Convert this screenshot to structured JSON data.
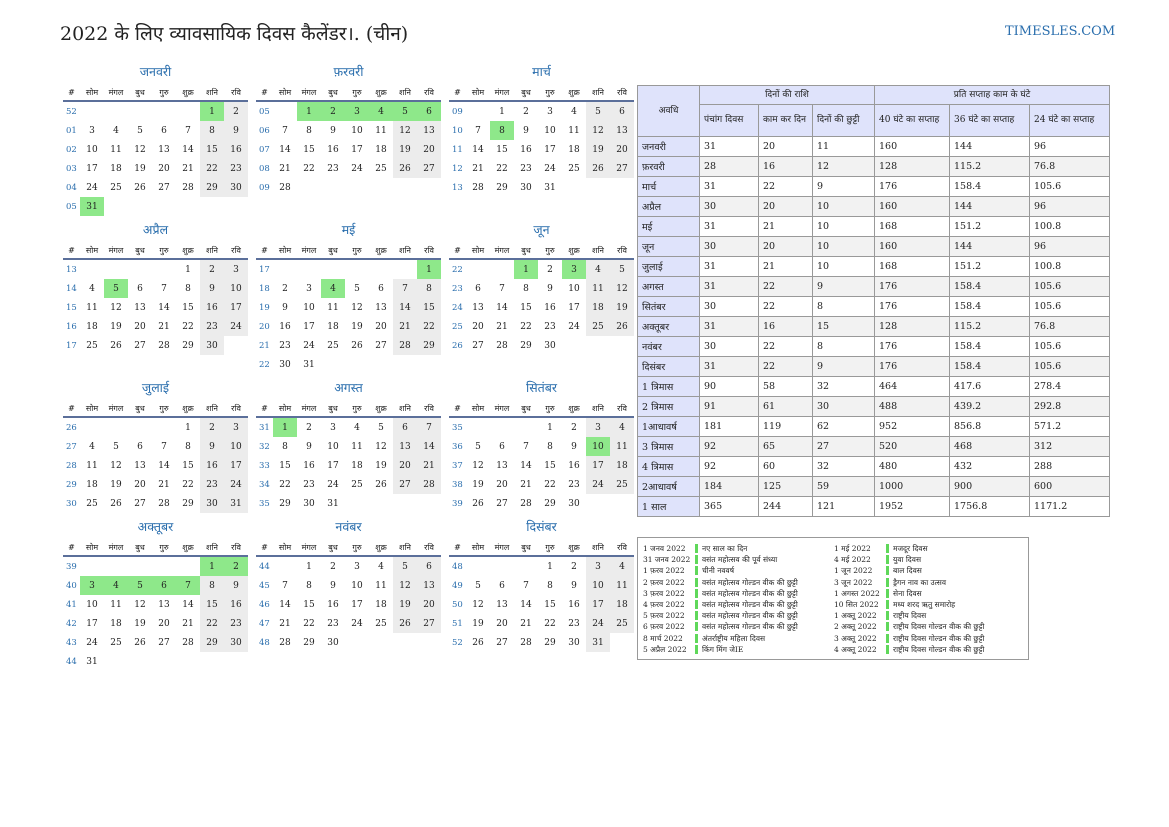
{
  "title": "2022 के लिए व्यावसायिक दिवस कैलेंडर।. (चीन)",
  "site": "TIMESLES.COM",
  "colors": {
    "accent": "#2a6ead",
    "holiday": "#8ee88a",
    "weekend": "#ececec",
    "header_bg": "#dfe3fb"
  },
  "weekday_headers": [
    "#",
    "सोम",
    "मंगल",
    "बुध",
    "गुरु",
    "शुक्र",
    "शनि",
    "रवि"
  ],
  "months": [
    {
      "name": "जनवरी",
      "weeks": [
        [
          "52",
          "",
          "",
          "",
          "",
          "",
          "1",
          "2"
        ],
        [
          "01",
          "3",
          "4",
          "5",
          "6",
          "7",
          "8",
          "9"
        ],
        [
          "02",
          "10",
          "11",
          "12",
          "13",
          "14",
          "15",
          "16"
        ],
        [
          "03",
          "17",
          "18",
          "19",
          "20",
          "21",
          "22",
          "23"
        ],
        [
          "04",
          "24",
          "25",
          "26",
          "27",
          "28",
          "29",
          "30"
        ],
        [
          "05",
          "31",
          "",
          "",
          "",
          "",
          "",
          ""
        ]
      ],
      "holidays": [
        1,
        31
      ]
    },
    {
      "name": "फ़रवरी",
      "weeks": [
        [
          "05",
          "",
          "1",
          "2",
          "3",
          "4",
          "5",
          "6"
        ],
        [
          "06",
          "7",
          "8",
          "9",
          "10",
          "11",
          "12",
          "13"
        ],
        [
          "07",
          "14",
          "15",
          "16",
          "17",
          "18",
          "19",
          "20"
        ],
        [
          "08",
          "21",
          "22",
          "23",
          "24",
          "25",
          "26",
          "27"
        ],
        [
          "09",
          "28",
          "",
          "",
          "",
          "",
          "",
          ""
        ]
      ],
      "holidays": [
        1,
        2,
        3,
        4,
        5,
        6
      ]
    },
    {
      "name": "मार्च",
      "weeks": [
        [
          "09",
          "",
          "1",
          "2",
          "3",
          "4",
          "5",
          "6"
        ],
        [
          "10",
          "7",
          "8",
          "9",
          "10",
          "11",
          "12",
          "13"
        ],
        [
          "11",
          "14",
          "15",
          "16",
          "17",
          "18",
          "19",
          "20"
        ],
        [
          "12",
          "21",
          "22",
          "23",
          "24",
          "25",
          "26",
          "27"
        ],
        [
          "13",
          "28",
          "29",
          "30",
          "31",
          "",
          "",
          ""
        ]
      ],
      "holidays": [
        8
      ]
    },
    {
      "name": "अप्रैल",
      "weeks": [
        [
          "13",
          "",
          "",
          "",
          "",
          "1",
          "2",
          "3"
        ],
        [
          "14",
          "4",
          "5",
          "6",
          "7",
          "8",
          "9",
          "10"
        ],
        [
          "15",
          "11",
          "12",
          "13",
          "14",
          "15",
          "16",
          "17"
        ],
        [
          "16",
          "18",
          "19",
          "20",
          "21",
          "22",
          "23",
          "24"
        ],
        [
          "17",
          "25",
          "26",
          "27",
          "28",
          "29",
          "30",
          ""
        ]
      ],
      "holidays": [
        5
      ]
    },
    {
      "name": "मई",
      "weeks": [
        [
          "17",
          "",
          "",
          "",
          "",
          "",
          "",
          "1"
        ],
        [
          "18",
          "2",
          "3",
          "4",
          "5",
          "6",
          "7",
          "8"
        ],
        [
          "19",
          "9",
          "10",
          "11",
          "12",
          "13",
          "14",
          "15"
        ],
        [
          "20",
          "16",
          "17",
          "18",
          "19",
          "20",
          "21",
          "22"
        ],
        [
          "21",
          "23",
          "24",
          "25",
          "26",
          "27",
          "28",
          "29"
        ],
        [
          "22",
          "30",
          "31",
          "",
          "",
          "",
          "",
          ""
        ]
      ],
      "holidays": [
        1,
        4
      ]
    },
    {
      "name": "जून",
      "weeks": [
        [
          "22",
          "",
          "",
          "1",
          "2",
          "3",
          "4",
          "5"
        ],
        [
          "23",
          "6",
          "7",
          "8",
          "9",
          "10",
          "11",
          "12"
        ],
        [
          "24",
          "13",
          "14",
          "15",
          "16",
          "17",
          "18",
          "19"
        ],
        [
          "25",
          "20",
          "21",
          "22",
          "23",
          "24",
          "25",
          "26"
        ],
        [
          "26",
          "27",
          "28",
          "29",
          "30",
          "",
          "",
          ""
        ]
      ],
      "holidays": [
        1,
        3
      ]
    },
    {
      "name": "जुलाई",
      "weeks": [
        [
          "26",
          "",
          "",
          "",
          "",
          "1",
          "2",
          "3"
        ],
        [
          "27",
          "4",
          "5",
          "6",
          "7",
          "8",
          "9",
          "10"
        ],
        [
          "28",
          "11",
          "12",
          "13",
          "14",
          "15",
          "16",
          "17"
        ],
        [
          "29",
          "18",
          "19",
          "20",
          "21",
          "22",
          "23",
          "24"
        ],
        [
          "30",
          "25",
          "26",
          "27",
          "28",
          "29",
          "30",
          "31"
        ]
      ],
      "holidays": []
    },
    {
      "name": "अगस्त",
      "weeks": [
        [
          "31",
          "1",
          "2",
          "3",
          "4",
          "5",
          "6",
          "7"
        ],
        [
          "32",
          "8",
          "9",
          "10",
          "11",
          "12",
          "13",
          "14"
        ],
        [
          "33",
          "15",
          "16",
          "17",
          "18",
          "19",
          "20",
          "21"
        ],
        [
          "34",
          "22",
          "23",
          "24",
          "25",
          "26",
          "27",
          "28"
        ],
        [
          "35",
          "29",
          "30",
          "31",
          "",
          "",
          "",
          ""
        ]
      ],
      "holidays": [
        1
      ]
    },
    {
      "name": "सितंबर",
      "weeks": [
        [
          "35",
          "",
          "",
          "",
          "1",
          "2",
          "3",
          "4"
        ],
        [
          "36",
          "5",
          "6",
          "7",
          "8",
          "9",
          "10",
          "11"
        ],
        [
          "37",
          "12",
          "13",
          "14",
          "15",
          "16",
          "17",
          "18"
        ],
        [
          "38",
          "19",
          "20",
          "21",
          "22",
          "23",
          "24",
          "25"
        ],
        [
          "39",
          "26",
          "27",
          "28",
          "29",
          "30",
          "",
          ""
        ]
      ],
      "holidays": [
        10
      ]
    },
    {
      "name": "अक्तूबर",
      "weeks": [
        [
          "39",
          "",
          "",
          "",
          "",
          "",
          "1",
          "2"
        ],
        [
          "40",
          "3",
          "4",
          "5",
          "6",
          "7",
          "8",
          "9"
        ],
        [
          "41",
          "10",
          "11",
          "12",
          "13",
          "14",
          "15",
          "16"
        ],
        [
          "42",
          "17",
          "18",
          "19",
          "20",
          "21",
          "22",
          "23"
        ],
        [
          "43",
          "24",
          "25",
          "26",
          "27",
          "28",
          "29",
          "30"
        ],
        [
          "44",
          "31",
          "",
          "",
          "",
          "",
          "",
          ""
        ]
      ],
      "holidays": [
        1,
        2,
        3,
        4,
        5,
        6,
        7
      ]
    },
    {
      "name": "नवंबर",
      "weeks": [
        [
          "44",
          "",
          "1",
          "2",
          "3",
          "4",
          "5",
          "6"
        ],
        [
          "45",
          "7",
          "8",
          "9",
          "10",
          "11",
          "12",
          "13"
        ],
        [
          "46",
          "14",
          "15",
          "16",
          "17",
          "18",
          "19",
          "20"
        ],
        [
          "47",
          "21",
          "22",
          "23",
          "24",
          "25",
          "26",
          "27"
        ],
        [
          "48",
          "28",
          "29",
          "30",
          "",
          "",
          "",
          ""
        ]
      ],
      "holidays": []
    },
    {
      "name": "दिसंबर",
      "weeks": [
        [
          "48",
          "",
          "",
          "",
          "1",
          "2",
          "3",
          "4"
        ],
        [
          "49",
          "5",
          "6",
          "7",
          "8",
          "9",
          "10",
          "11"
        ],
        [
          "50",
          "12",
          "13",
          "14",
          "15",
          "16",
          "17",
          "18"
        ],
        [
          "51",
          "19",
          "20",
          "21",
          "22",
          "23",
          "24",
          "25"
        ],
        [
          "52",
          "26",
          "27",
          "28",
          "29",
          "30",
          "31",
          ""
        ]
      ],
      "holidays": []
    }
  ],
  "summary": {
    "group1": "दिनों की राशि",
    "group2": "प्रति सप्ताह काम के घंटे",
    "headers": [
      "अवधि",
      "पंचांग दिवस",
      "काम कर दिन",
      "दिनों की छुट्टी",
      "40 घंटे का सप्ताह",
      "36 घंटे का सप्ताह",
      "24 घंटे का सप्ताह"
    ],
    "rows": [
      [
        "जनवरी",
        "31",
        "20",
        "11",
        "160",
        "144",
        "96"
      ],
      [
        "फ़रवरी",
        "28",
        "16",
        "12",
        "128",
        "115.2",
        "76.8"
      ],
      [
        "मार्च",
        "31",
        "22",
        "9",
        "176",
        "158.4",
        "105.6"
      ],
      [
        "अप्रैल",
        "30",
        "20",
        "10",
        "160",
        "144",
        "96"
      ],
      [
        "मई",
        "31",
        "21",
        "10",
        "168",
        "151.2",
        "100.8"
      ],
      [
        "जून",
        "30",
        "20",
        "10",
        "160",
        "144",
        "96"
      ],
      [
        "जुलाई",
        "31",
        "21",
        "10",
        "168",
        "151.2",
        "100.8"
      ],
      [
        "अगस्त",
        "31",
        "22",
        "9",
        "176",
        "158.4",
        "105.6"
      ],
      [
        "सितंबर",
        "30",
        "22",
        "8",
        "176",
        "158.4",
        "105.6"
      ],
      [
        "अक्तूबर",
        "31",
        "16",
        "15",
        "128",
        "115.2",
        "76.8"
      ],
      [
        "नवंबर",
        "30",
        "22",
        "8",
        "176",
        "158.4",
        "105.6"
      ],
      [
        "दिसंबर",
        "31",
        "22",
        "9",
        "176",
        "158.4",
        "105.6"
      ],
      [
        "1 त्रिमास",
        "90",
        "58",
        "32",
        "464",
        "417.6",
        "278.4"
      ],
      [
        "2 त्रिमास",
        "91",
        "61",
        "30",
        "488",
        "439.2",
        "292.8"
      ],
      [
        "1आधावर्ष",
        "181",
        "119",
        "62",
        "952",
        "856.8",
        "571.2"
      ],
      [
        "3 त्रिमास",
        "92",
        "65",
        "27",
        "520",
        "468",
        "312"
      ],
      [
        "4 त्रिमास",
        "92",
        "60",
        "32",
        "480",
        "432",
        "288"
      ],
      [
        "2आधावर्ष",
        "184",
        "125",
        "59",
        "1000",
        "900",
        "600"
      ],
      [
        "1 साल",
        "365",
        "244",
        "121",
        "1952",
        "1756.8",
        "1171.2"
      ]
    ]
  },
  "holiday_list": {
    "col1": [
      {
        "date": "1 जनव 2022",
        "name": "नए साल का दिन"
      },
      {
        "date": "31 जनव 2022",
        "name": "वसंत महोत्सव की पूर्व संध्या"
      },
      {
        "date": "1 फ़रव 2022",
        "name": "चीनी नववर्ष"
      },
      {
        "date": "2 फ़रव 2022",
        "name": "वसंत महोत्सव गोल्डन वीक की छुट्टी"
      },
      {
        "date": "3 फ़रव 2022",
        "name": "वसंत महोत्सव गोल्डन वीक की छुट्टी"
      },
      {
        "date": "4 फ़रव 2022",
        "name": "वसंत महोत्सव गोल्डन वीक की छुट्टी"
      },
      {
        "date": "5 फ़रव 2022",
        "name": "वसंत महोत्सव गोल्डन वीक की छुट्टी"
      },
      {
        "date": "6 फ़रव 2022",
        "name": "वसंत महोत्सव गोल्डन वीक की छुट्टी"
      },
      {
        "date": "8 मार्च 2022",
        "name": "अंतर्राष्ट्रीय महिला दिवस"
      },
      {
        "date": "5 अप्रैल 2022",
        "name": "किंग मिंग जेIE"
      }
    ],
    "col2": [
      {
        "date": "1 मई 2022",
        "name": "मजदूर दिवस"
      },
      {
        "date": "4 मई 2022",
        "name": "युवा दिवस"
      },
      {
        "date": "1 जून 2022",
        "name": "बाल दिवस"
      },
      {
        "date": "3 जून 2022",
        "name": "ड्रैगन नाव का उत्सव"
      },
      {
        "date": "1 अगस्त 2022",
        "name": "सेना दिवस"
      },
      {
        "date": "10 सित 2022",
        "name": "मध्य शरद ऋतु समारोह"
      },
      {
        "date": "1 अक्तू 2022",
        "name": "राष्ट्रीय दिवस"
      },
      {
        "date": "2 अक्तू 2022",
        "name": "राष्ट्रीय दिवस गोल्डन वीक की छुट्टी"
      },
      {
        "date": "3 अक्तू 2022",
        "name": "राष्ट्रीय दिवस गोल्डन वीक की छुट्टी"
      },
      {
        "date": "4 अक्तू 2022",
        "name": "राष्ट्रीय दिवस गोल्डन वीक की छुट्टी"
      }
    ]
  }
}
